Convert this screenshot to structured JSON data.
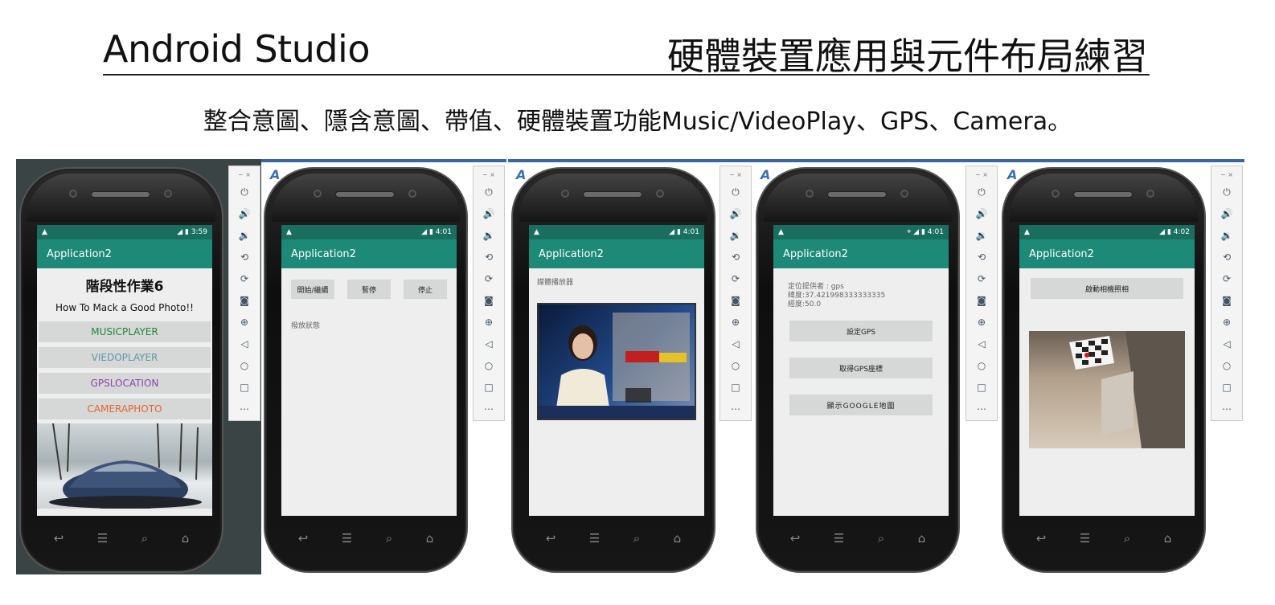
{
  "header": {
    "title_left": "Android Studio",
    "title_right": "硬體裝置應用與元件布局練習",
    "subtitle": "整合意圖、隱含意圖、帶值、硬體裝置功能Music/VideoPlay、GPS、Camera。"
  },
  "colors": {
    "appbar": "#1d8a78",
    "statusbar": "#1a6e60",
    "music": "#1d8a3a",
    "video": "#5b9aa8",
    "gps": "#8e44ad",
    "camera": "#e6642e"
  },
  "emulator": {
    "window_controls": "−  ×",
    "toolbar_icons": [
      "power-icon",
      "volume-up-icon",
      "volume-down-icon",
      "rotate-left-icon",
      "rotate-right-icon",
      "camera-icon",
      "zoom-icon",
      "back-icon",
      "home-icon",
      "overview-icon",
      "more-icon"
    ],
    "nav_icons": [
      "back-icon",
      "menu-icon",
      "search-icon",
      "home-icon"
    ]
  },
  "phones": [
    {
      "time": "3:59",
      "app_title": "Application2",
      "heading": "階段性作業6",
      "subheading": "How To Mack a Good Photo!!",
      "buttons": [
        "MUSICPLAYER",
        "VIEDOPLAYER",
        "GPSLOCATION",
        "CAMERAPHOTO"
      ]
    },
    {
      "time": "4:01",
      "app_title": "Application2",
      "buttons": [
        "開始/繼續",
        "暫停",
        "停止"
      ],
      "status_label": "撥放狀態"
    },
    {
      "time": "4:01",
      "app_title": "Application2",
      "label": "媒體播放器"
    },
    {
      "time": "4:01",
      "app_title": "Application2",
      "info_lines": [
        "定位提供者 : gps",
        "緯度:37.421998333333335",
        "經度:50.0"
      ],
      "buttons": [
        "設定GPS",
        "取得GPS座標",
        "顯示GOOGLE地圖"
      ]
    },
    {
      "time": "4:02",
      "app_title": "Application2",
      "button": "啟動相機照相"
    }
  ]
}
